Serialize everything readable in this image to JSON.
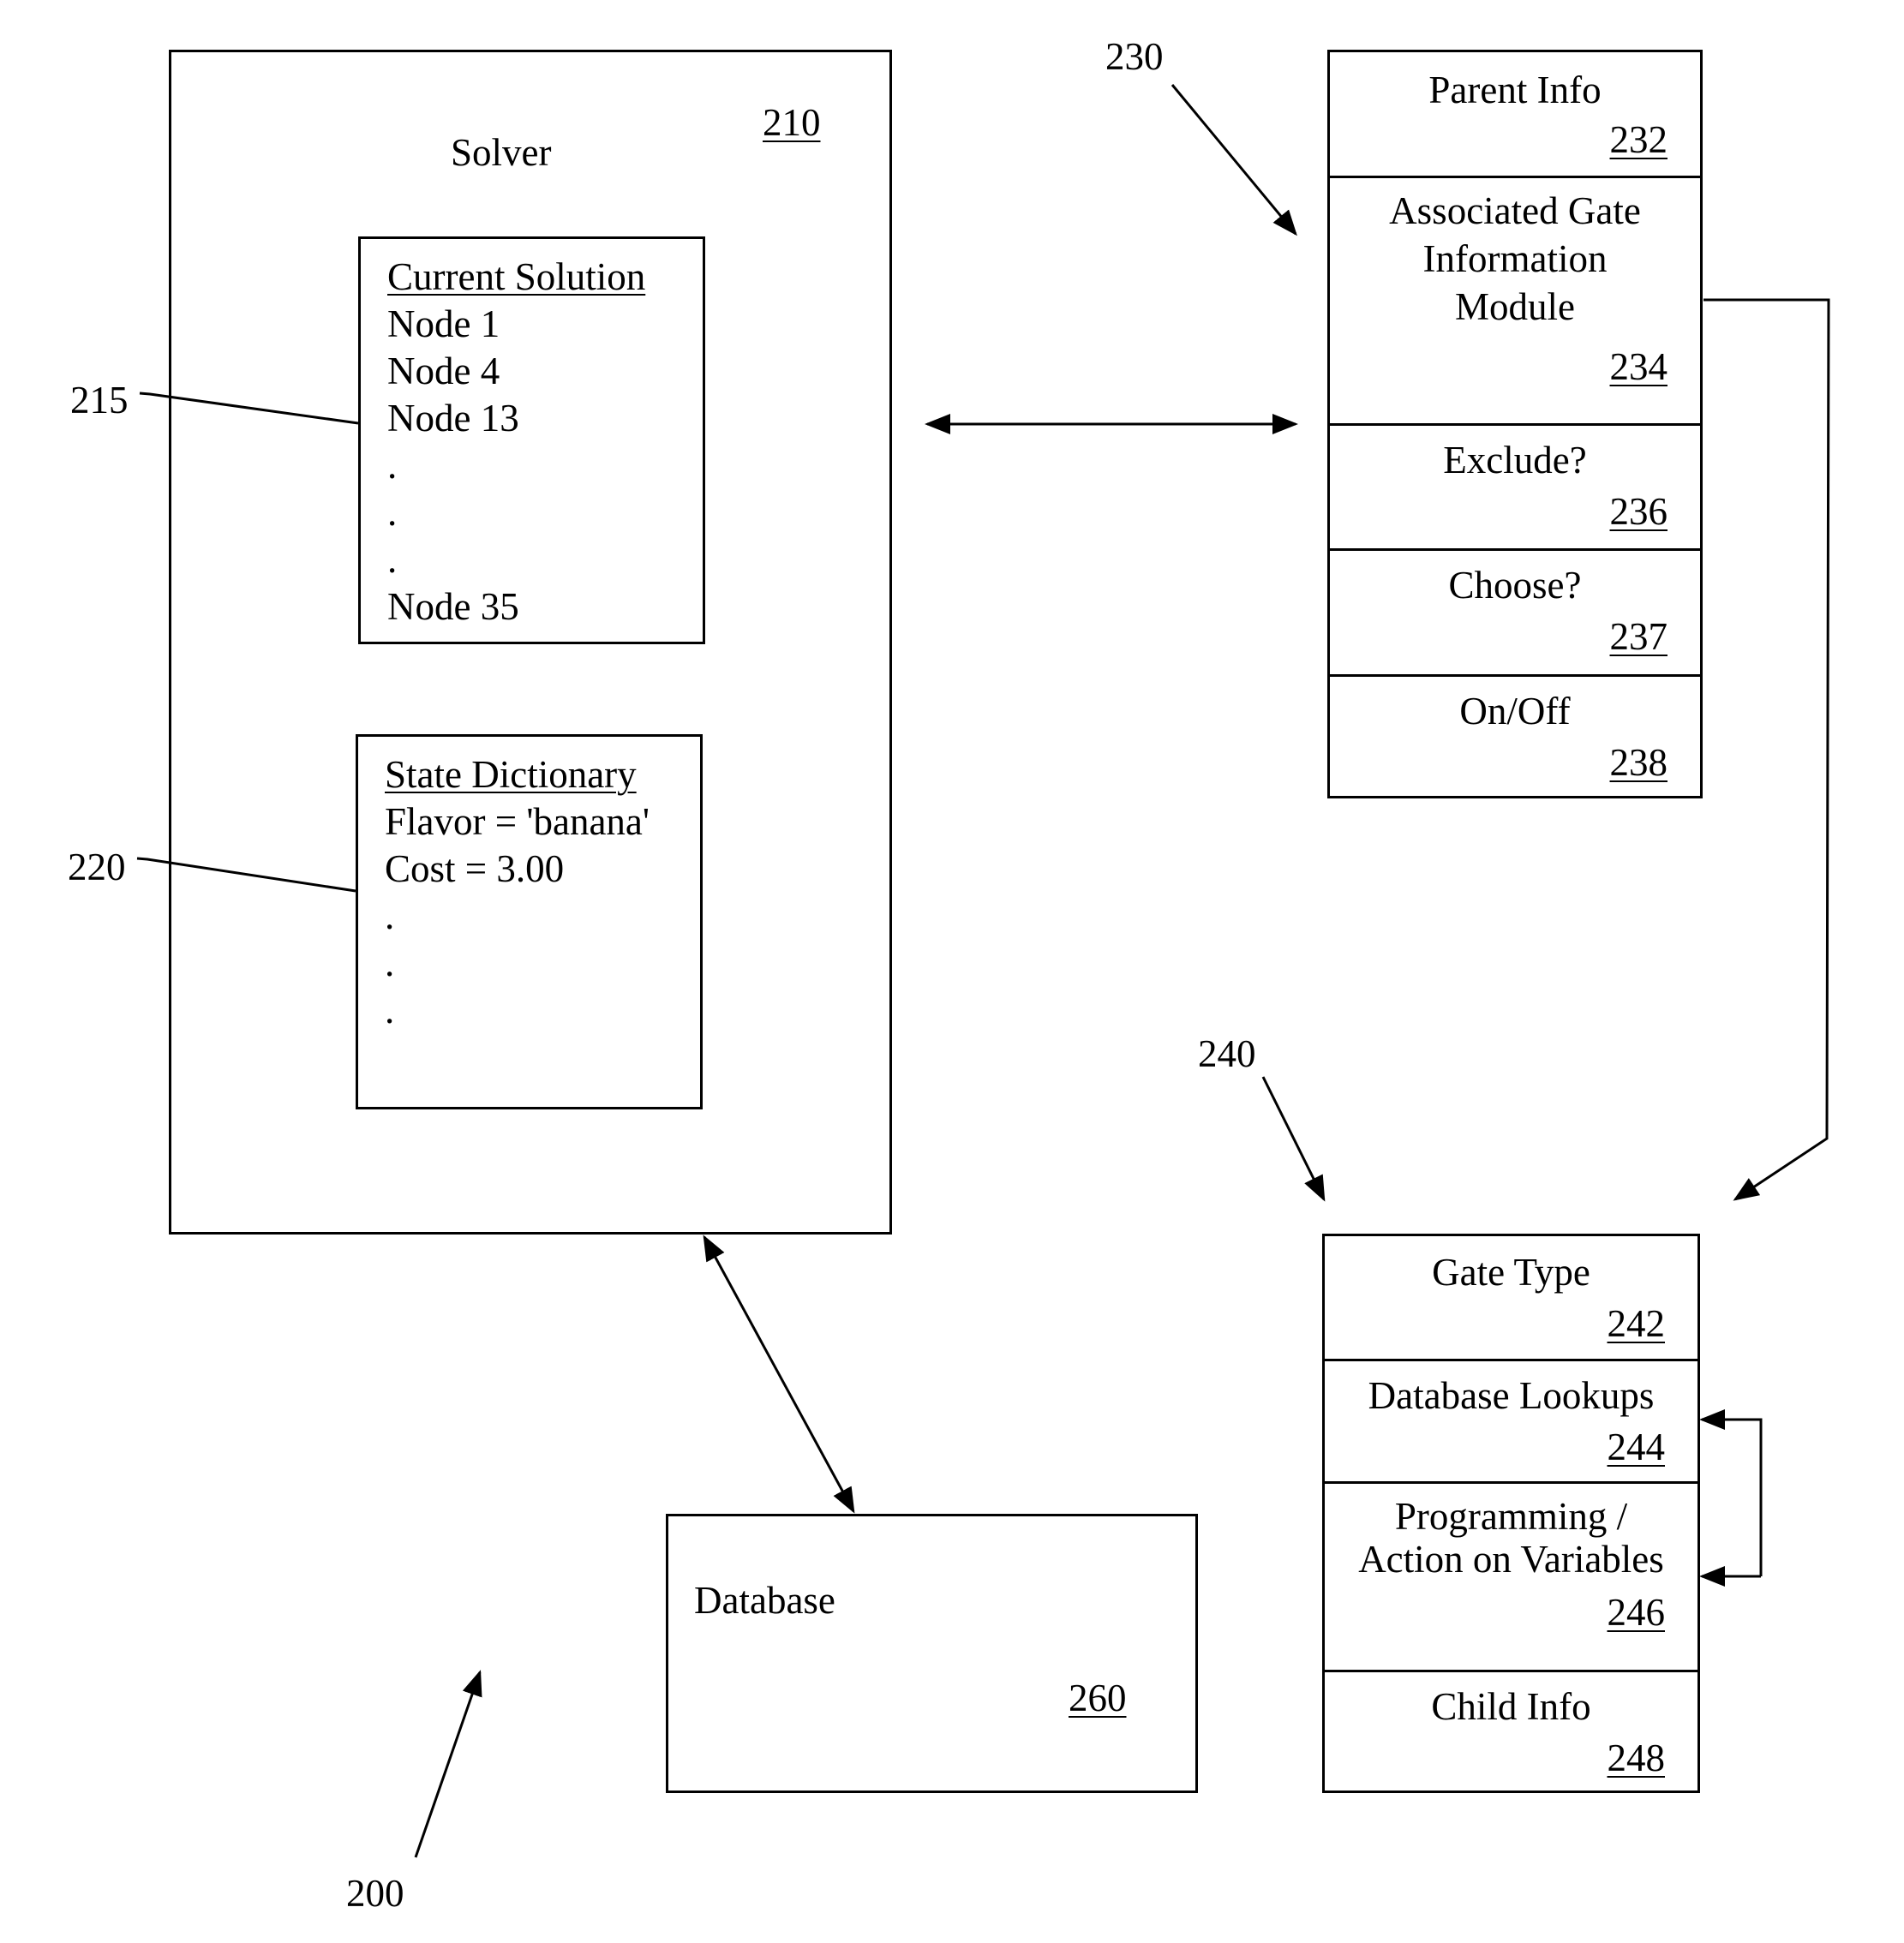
{
  "figure_label": "200",
  "solver": {
    "title": "Solver",
    "ref": "210",
    "current_solution": {
      "heading": "Current Solution",
      "ref": "215",
      "items": [
        "Node 1",
        "Node 4",
        "Node 13",
        ".",
        ".",
        ".",
        "Node 35"
      ]
    },
    "state_dictionary": {
      "heading": "State Dictionary",
      "ref": "220",
      "items": [
        "Flavor = 'banana'",
        "Cost = 3.00",
        ".",
        ".",
        "."
      ]
    }
  },
  "gate_info_module": {
    "ref": "230",
    "cells": [
      {
        "title": "Parent Info",
        "ref": "232"
      },
      {
        "title": "Associated Gate Information Module",
        "title_lines": [
          "Associated Gate",
          "Information",
          "Module"
        ],
        "ref": "234"
      },
      {
        "title": "Exclude?",
        "ref": "236"
      },
      {
        "title": "Choose?",
        "ref": "237"
      },
      {
        "title": "On/Off",
        "ref": "238"
      }
    ]
  },
  "gate_module": {
    "ref": "240",
    "cells": [
      {
        "title": "Gate Type",
        "ref": "242"
      },
      {
        "title": "Database Lookups",
        "ref": "244"
      },
      {
        "title": "Programming / Action on Variables",
        "title_lines": [
          "Programming /",
          "Action on Variables"
        ],
        "ref": "246"
      },
      {
        "title": "Child Info",
        "ref": "248"
      }
    ]
  },
  "database": {
    "title": "Database",
    "ref": "260"
  }
}
